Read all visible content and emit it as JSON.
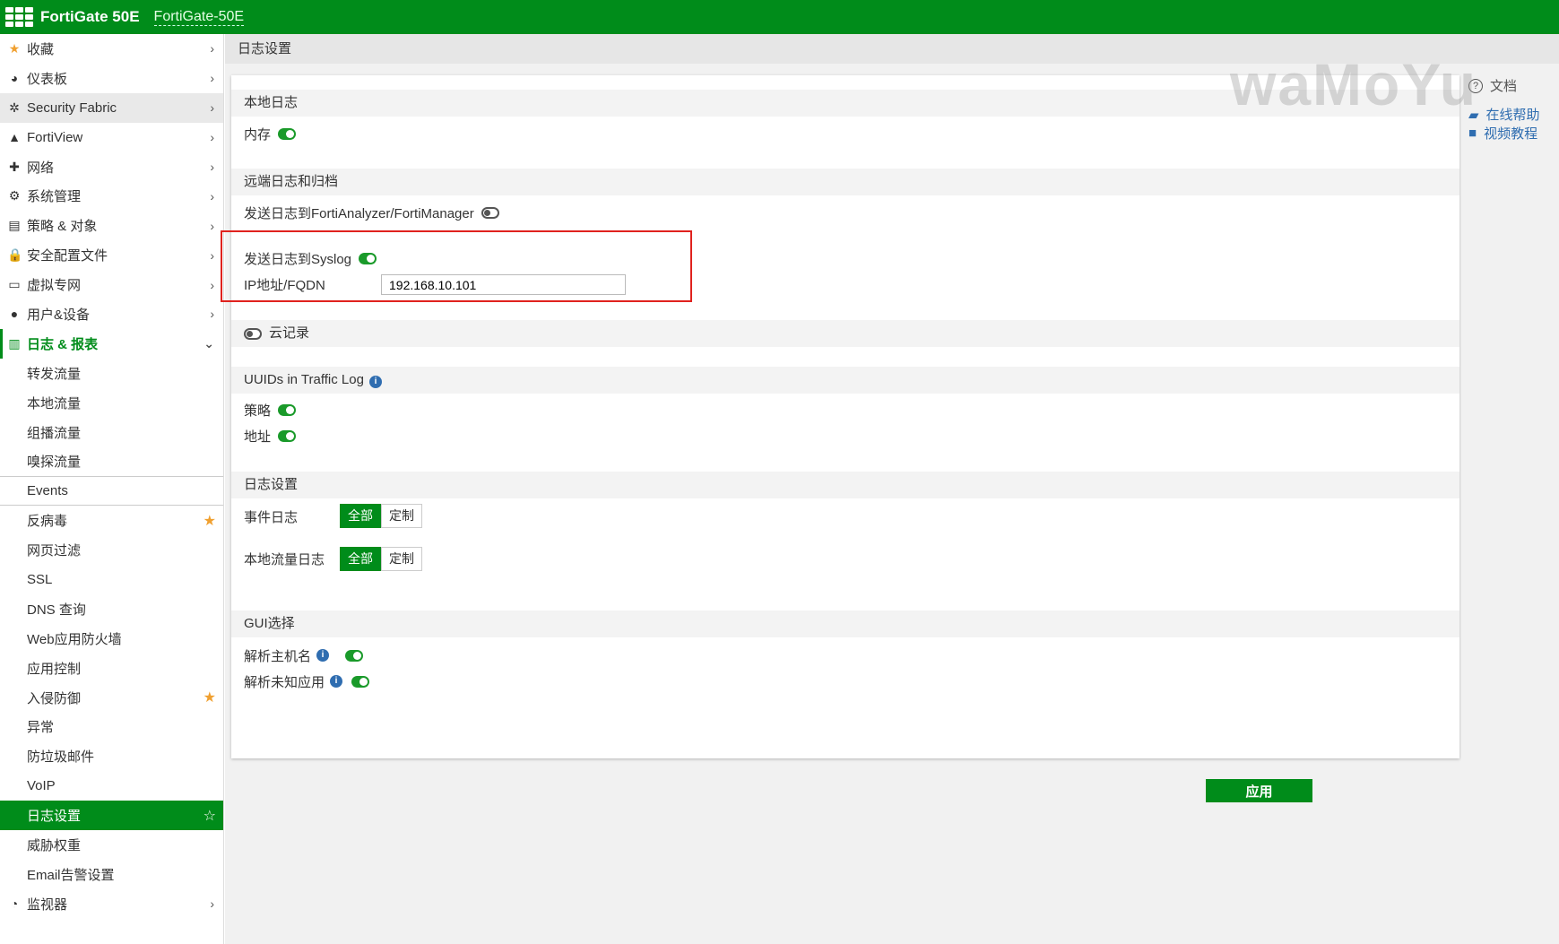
{
  "header": {
    "brand": "FortiGate 50E",
    "hostname": "FortiGate-50E"
  },
  "sidebar": {
    "items": [
      {
        "label": "收藏",
        "icon": "★"
      },
      {
        "label": "仪表板",
        "icon": "◕"
      },
      {
        "label": "Security Fabric",
        "icon": "✲"
      },
      {
        "label": "FortiView",
        "icon": "▲"
      },
      {
        "label": "网络",
        "icon": "✚"
      },
      {
        "label": "系统管理",
        "icon": "⚙"
      },
      {
        "label": "策略 & 对象",
        "icon": "▤"
      },
      {
        "label": "安全配置文件",
        "icon": "🔒"
      },
      {
        "label": "虚拟专网",
        "icon": "▭"
      },
      {
        "label": "用户&设备",
        "icon": "●"
      },
      {
        "label": "日志 & 报表",
        "icon": "▥"
      }
    ],
    "sub": [
      "转发流量",
      "本地流量",
      "组播流量",
      "嗅探流量",
      "Events",
      "反病毒",
      "网页过滤",
      "SSL",
      "DNS 查询",
      "Web应用防火墙",
      "应用控制",
      "入侵防御",
      "异常",
      "防垃圾邮件",
      "VoIP",
      "日志设置",
      "威胁权重",
      "Email告警设置"
    ],
    "monitor": {
      "label": "监视器",
      "icon": "◔"
    }
  },
  "page_title": "日志设置",
  "form": {
    "local_log": "本地日志",
    "memory": "内存",
    "remote": "远端日志和归档",
    "faz": "发送日志到FortiAnalyzer/FortiManager",
    "syslog": "发送日志到Syslog",
    "ip_label": "IP地址/FQDN",
    "ip_value": "192.168.10.101",
    "cloud": "云记录",
    "uuid": "UUIDs in Traffic Log",
    "policy": "策略",
    "address": "地址",
    "log_settings": "日志设置",
    "event_log": "事件日志",
    "local_traffic_log": "本地流量日志",
    "all": "全部",
    "custom": "定制",
    "gui": "GUI选择",
    "resolve_host": "解析主机名",
    "resolve_app": "解析未知应用"
  },
  "right": {
    "docs": "文档",
    "online_help": "在线帮助",
    "video": "视频教程"
  },
  "watermark": "waMoYu",
  "apply": "应用"
}
